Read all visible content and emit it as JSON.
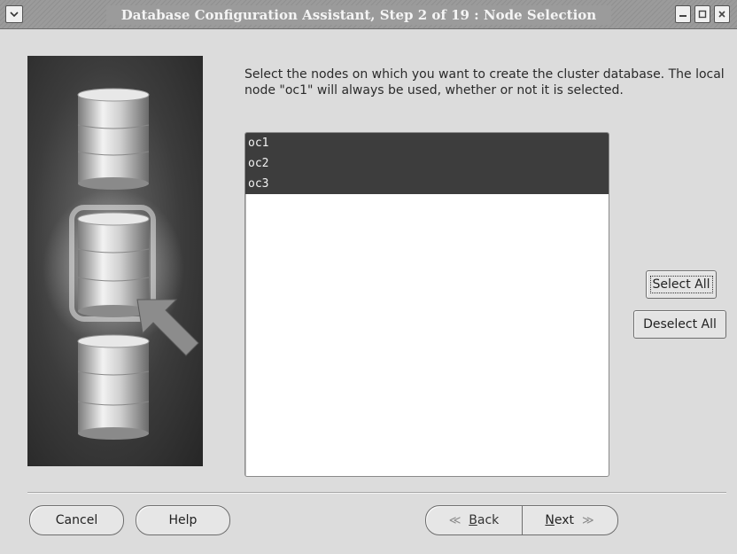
{
  "window": {
    "title": "Database Configuration Assistant, Step 2 of 19 : Node Selection",
    "icons": [
      "window-menu-icon",
      "minimize-icon",
      "maximize-icon",
      "close-icon"
    ]
  },
  "instructions": "Select the nodes on which you want to create the cluster database. The local node \"oc1\" will always be used, whether or not it is selected.",
  "nodes": [
    {
      "name": "oc1",
      "selected": true
    },
    {
      "name": "oc2",
      "selected": true
    },
    {
      "name": "oc3",
      "selected": true
    }
  ],
  "buttons": {
    "select_all": "Select All",
    "deselect_all": "Deselect All",
    "cancel": "Cancel",
    "help": "Help",
    "back": "Back",
    "next": "Next"
  },
  "colors": {
    "selection": "#3d3d3d",
    "background": "#dcdcdc"
  }
}
